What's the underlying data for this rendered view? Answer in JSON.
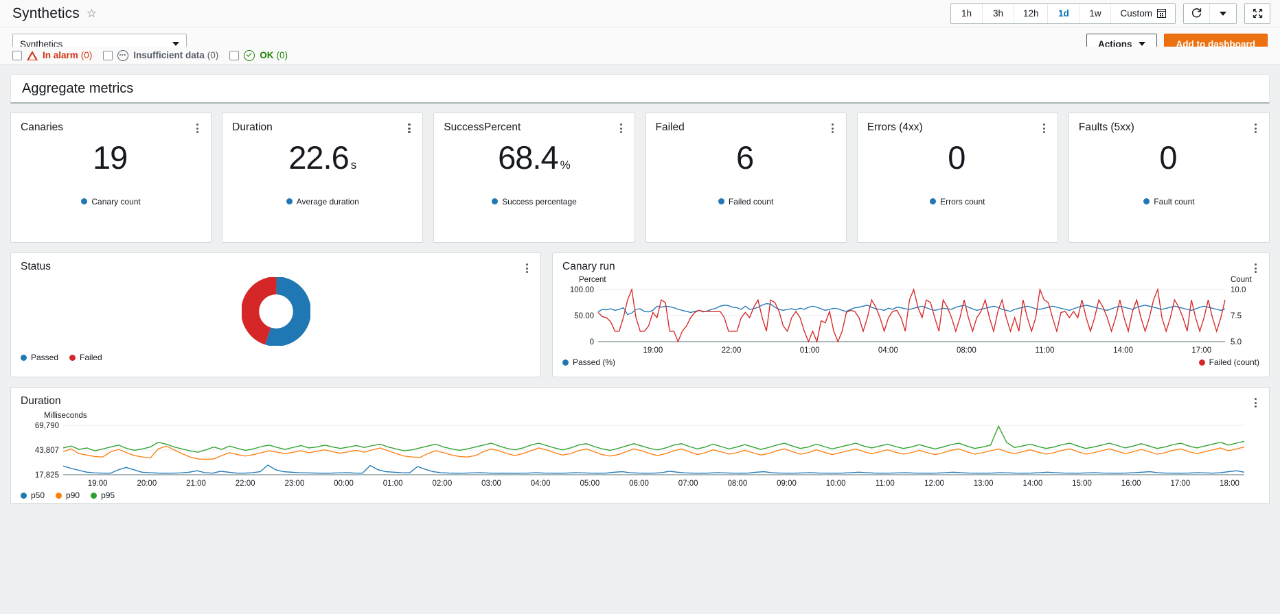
{
  "header": {
    "title": "Synthetics",
    "star_icon": "star-outline-icon",
    "time_ranges": [
      {
        "label": "1h",
        "active": false
      },
      {
        "label": "3h",
        "active": false
      },
      {
        "label": "12h",
        "active": false
      },
      {
        "label": "1d",
        "active": true
      },
      {
        "label": "1w",
        "active": false
      },
      {
        "label": "Custom",
        "active": false,
        "icon": "calendar-icon"
      }
    ],
    "refresh_icon": "refresh-icon",
    "refresh_dropdown_icon": "chevron-down-icon",
    "fullscreen_icon": "expand-icon"
  },
  "filters": {
    "namespace_select_value": "Synthetics",
    "select_caret_icon": "chevron-down-icon",
    "actions_label": "Actions",
    "actions_caret_icon": "chevron-down-icon",
    "add_to_dashboard_label": "Add to dashboard",
    "primary_color": "#ec7211",
    "statuses": [
      {
        "label": "In alarm",
        "count": "(0)",
        "color": "#d13212",
        "icon": "alarm-triangle-icon",
        "checked": false
      },
      {
        "label": "Insufficient data",
        "count": "(0)",
        "color": "#545b64",
        "icon": "insufficient-data-icon",
        "checked": false
      },
      {
        "label": "OK",
        "count": "(0)",
        "color": "#1d8102",
        "icon": "check-circle-icon",
        "checked": false
      }
    ]
  },
  "section": {
    "title": "Aggregate metrics"
  },
  "kpis": [
    {
      "title": "Canaries",
      "value": "19",
      "unit": "",
      "legend": "Canary count",
      "color": "#1f77b4",
      "menu_icon": "kebab-menu-icon"
    },
    {
      "title": "Duration",
      "value": "22.6",
      "unit": "s",
      "legend": "Average duration",
      "color": "#1f77b4",
      "menu_icon": "kebab-menu-icon"
    },
    {
      "title": "SuccessPercent",
      "value": "68.4",
      "unit": "%",
      "legend": "Success percentage",
      "color": "#1f77b4",
      "menu_icon": "kebab-menu-icon"
    },
    {
      "title": "Failed",
      "value": "6",
      "unit": "",
      "legend": "Failed count",
      "color": "#1f77b4",
      "menu_icon": "kebab-menu-icon"
    },
    {
      "title": "Errors (4xx)",
      "value": "0",
      "unit": "",
      "legend": "Errors count",
      "color": "#1f77b4",
      "menu_icon": "kebab-menu-icon"
    },
    {
      "title": "Faults (5xx)",
      "value": "0",
      "unit": "",
      "legend": "Fault count",
      "color": "#1f77b4",
      "menu_icon": "kebab-menu-icon"
    }
  ],
  "status_panel": {
    "title": "Status",
    "menu_icon": "kebab-menu-icon",
    "legend": [
      {
        "label": "Passed",
        "color": "#1f77b4"
      },
      {
        "label": "Failed",
        "color": "#d62728"
      }
    ]
  },
  "canary_panel": {
    "title": "Canary run",
    "menu_icon": "kebab-menu-icon",
    "legend": [
      {
        "label": "Passed (%)",
        "color": "#1f77b4"
      },
      {
        "label": "Failed (count)",
        "color": "#d62728"
      }
    ]
  },
  "duration_panel": {
    "title": "Duration",
    "menu_icon": "kebab-menu-icon",
    "legend": [
      {
        "label": "p50",
        "color": "#1f77b4"
      },
      {
        "label": "p90",
        "color": "#ff7f0e"
      },
      {
        "label": "p95",
        "color": "#2ca02c"
      }
    ]
  },
  "chart_data": [
    {
      "type": "pie",
      "title": "Status",
      "name": "status-donut",
      "labels": [
        "Passed",
        "Failed"
      ],
      "values": [
        55,
        45
      ],
      "colors": [
        "#1f77b4",
        "#d62728"
      ],
      "donut": true,
      "legend_position": "bottom-left"
    },
    {
      "type": "line",
      "title": "Canary run",
      "name": "canary-run-chart",
      "xlabel": "",
      "ylabel": "Percent",
      "y2label": "Count",
      "xticks": [
        "19:00",
        "22:00",
        "01:00",
        "04:00",
        "08:00",
        "11:00",
        "14:00",
        "17:00"
      ],
      "yticks": [
        "0",
        "50.00",
        "100.00"
      ],
      "ylim": [
        0,
        100
      ],
      "y2ticks": [
        "5.0",
        "7.5",
        "10.0"
      ],
      "y2lim": [
        5.0,
        10.0
      ],
      "grid": true,
      "legend_position": "bottom",
      "series": [
        {
          "name": "Passed (%)",
          "color": "#1f77b4",
          "axis": "left",
          "values": [
            57,
            62,
            61,
            63,
            60,
            62,
            65,
            52,
            55,
            62,
            63,
            58,
            57,
            60,
            68,
            66,
            68,
            67,
            65,
            62,
            60,
            58,
            56,
            58,
            60,
            57,
            59,
            62,
            64,
            68,
            70,
            69,
            66,
            65,
            62,
            68,
            62,
            63,
            66,
            70,
            73,
            72,
            66,
            62,
            60,
            62,
            63,
            61,
            64,
            62,
            66,
            68,
            66,
            63,
            60,
            62,
            64,
            63,
            60,
            58,
            62,
            65,
            66,
            68,
            70,
            66,
            63,
            62,
            60,
            64,
            62,
            66,
            65,
            63,
            62,
            64,
            66,
            68,
            65,
            62,
            60,
            62,
            64,
            63,
            62,
            66,
            68,
            70,
            66,
            63,
            60,
            62,
            64,
            66,
            68,
            66,
            62,
            60,
            58,
            62,
            64,
            66,
            68,
            66,
            63,
            62,
            64,
            66,
            68,
            66,
            64,
            62,
            60,
            63,
            66,
            68,
            70,
            68,
            66,
            64,
            62,
            60,
            63,
            66,
            68,
            66,
            64,
            62,
            66,
            68,
            70,
            68,
            66,
            64,
            62,
            64,
            66,
            68,
            66,
            64,
            62,
            60,
            63,
            66,
            68,
            66,
            64,
            62,
            60,
            63
          ]
        },
        {
          "name": "Failed (count)",
          "color": "#d62728",
          "axis": "right",
          "values": [
            56,
            48,
            46,
            38,
            20,
            20,
            46,
            80,
            100,
            46,
            20,
            20,
            30,
            56,
            46,
            80,
            75,
            20,
            20,
            0,
            20,
            30,
            46,
            56,
            60,
            58,
            58,
            58,
            58,
            58,
            46,
            20,
            20,
            20,
            46,
            56,
            46,
            66,
            80,
            46,
            20,
            80,
            75,
            58,
            30,
            20,
            46,
            58,
            46,
            20,
            0,
            20,
            0,
            40,
            36,
            58,
            20,
            0,
            20,
            56,
            60,
            58,
            46,
            20,
            46,
            80,
            66,
            46,
            20,
            46,
            58,
            60,
            46,
            20,
            80,
            100,
            66,
            46,
            80,
            75,
            46,
            20,
            80,
            66,
            46,
            20,
            46,
            80,
            46,
            20,
            46,
            58,
            80,
            46,
            20,
            58,
            80,
            46,
            20,
            46,
            20,
            80,
            46,
            20,
            46,
            100,
            80,
            75,
            46,
            20,
            56,
            58,
            46,
            58,
            46,
            80,
            46,
            20,
            46,
            80,
            66,
            46,
            20,
            46,
            80,
            46,
            20,
            58,
            80,
            46,
            20,
            46,
            80,
            100,
            46,
            20,
            46,
            80,
            66,
            46,
            20,
            80,
            46,
            20,
            46,
            80,
            46,
            20,
            46,
            80
          ]
        }
      ]
    },
    {
      "type": "line",
      "title": "Duration",
      "name": "duration-chart",
      "xlabel": "",
      "ylabel": "Milliseconds",
      "xticks": [
        "19:00",
        "20:00",
        "21:00",
        "22:00",
        "23:00",
        "00:00",
        "01:00",
        "02:00",
        "03:00",
        "04:00",
        "05:00",
        "06:00",
        "07:00",
        "08:00",
        "09:00",
        "10:00",
        "11:00",
        "12:00",
        "13:00",
        "14:00",
        "15:00",
        "16:00",
        "17:00",
        "18:00"
      ],
      "yticks": [
        "17,825",
        "43,807",
        "69,790"
      ],
      "ylim": [
        17825,
        69790
      ],
      "grid": true,
      "legend_position": "bottom",
      "series": [
        {
          "name": "p50",
          "color": "#1f77b4",
          "values": [
            27000,
            24500,
            22500,
            20500,
            19800,
            19500,
            19400,
            23000,
            25500,
            23000,
            20500,
            20000,
            19600,
            19400,
            19500,
            19800,
            20500,
            22000,
            20000,
            19500,
            21500,
            20500,
            19600,
            19500,
            20000,
            21000,
            28000,
            23000,
            21000,
            20500,
            20000,
            19800,
            19600,
            19400,
            19500,
            19800,
            20000,
            19600,
            19500,
            27500,
            23000,
            21000,
            20500,
            20000,
            19800,
            26500,
            23500,
            21000,
            20000,
            19600,
            19400,
            19500,
            19800,
            20000,
            19600,
            19400,
            19500,
            19300,
            19400,
            19500,
            20000,
            19600,
            19500,
            19400,
            19600,
            20000,
            19800,
            19500,
            19400,
            19600,
            20500,
            21000,
            20000,
            19600,
            19400,
            19500,
            20000,
            21500,
            20500,
            19800,
            19500,
            19400,
            19600,
            20000,
            19800,
            19500,
            19400,
            19600,
            20500,
            21000,
            20000,
            19600,
            19400,
            19500,
            19800,
            20000,
            19600,
            19500,
            19400,
            19600,
            20000,
            20500,
            20000,
            19600,
            19400,
            19500,
            19800,
            20000,
            19600,
            19500,
            19400,
            19600,
            20000,
            20500,
            20000,
            19600,
            19500,
            19400,
            19600,
            20000,
            19800,
            19500,
            19400,
            19600,
            20000,
            20500,
            20000,
            19600,
            19500,
            19400,
            19800,
            20000,
            19600,
            19500,
            19400,
            19600,
            20000,
            20500,
            21000,
            20000,
            19600,
            19500,
            19400,
            19600,
            20000,
            19800,
            19500,
            20000,
            21000,
            22000,
            20500
          ]
        },
        {
          "name": "p90",
          "color": "#ff7f0e",
          "values": [
            42000,
            45000,
            40000,
            38500,
            37000,
            36500,
            42000,
            44500,
            41000,
            38000,
            36500,
            35500,
            45000,
            48000,
            44000,
            40000,
            36500,
            34500,
            34000,
            34500,
            38000,
            41000,
            39000,
            37500,
            39000,
            41000,
            43000,
            41500,
            40000,
            41500,
            43000,
            41000,
            42500,
            44000,
            42000,
            40500,
            42000,
            43500,
            41500,
            44000,
            46000,
            43000,
            40000,
            37500,
            36500,
            36000,
            40000,
            43000,
            41000,
            38500,
            37000,
            36500,
            38000,
            42000,
            45000,
            43000,
            40000,
            38000,
            40000,
            43000,
            46000,
            44000,
            41000,
            38500,
            40000,
            43000,
            45000,
            42000,
            39000,
            37500,
            39000,
            42000,
            45000,
            43000,
            40000,
            38000,
            40000,
            43000,
            45000,
            42000,
            39000,
            41000,
            44000,
            42000,
            39500,
            41000,
            43500,
            41000,
            38500,
            40000,
            43000,
            45000,
            42000,
            39500,
            41000,
            44000,
            41500,
            39000,
            41000,
            43000,
            45000,
            42000,
            40000,
            42000,
            44000,
            41500,
            39500,
            41000,
            43500,
            41000,
            39000,
            41000,
            43500,
            45000,
            42000,
            39500,
            41000,
            43000,
            45000,
            42000,
            40000,
            42000,
            44000,
            41500,
            39500,
            41000,
            43500,
            45000,
            42000,
            39500,
            41000,
            43000,
            45000,
            42500,
            40000,
            42000,
            44500,
            42000,
            39500,
            41000,
            43500,
            45000,
            42000,
            40000,
            42000,
            44000,
            46000,
            43000,
            45000,
            47000
          ]
        },
        {
          "name": "p95",
          "color": "#2ca02c",
          "values": [
            46000,
            48000,
            44500,
            46000,
            43000,
            45000,
            47000,
            49000,
            45500,
            43500,
            45000,
            47000,
            52000,
            50000,
            47000,
            45000,
            43000,
            41500,
            44000,
            47000,
            44500,
            48000,
            45500,
            43500,
            45000,
            47500,
            49000,
            46500,
            44500,
            46500,
            48500,
            46000,
            47000,
            49000,
            47000,
            45500,
            47000,
            48500,
            46500,
            48500,
            50000,
            47000,
            45000,
            43000,
            44000,
            46000,
            48000,
            50000,
            47000,
            45000,
            43500,
            45000,
            47000,
            49000,
            51000,
            48000,
            45500,
            44000,
            46000,
            49000,
            51000,
            48500,
            46000,
            44000,
            46000,
            49000,
            50500,
            47500,
            45000,
            43500,
            45500,
            48000,
            50500,
            48000,
            45500,
            44000,
            46000,
            49000,
            50500,
            47500,
            45000,
            47000,
            50000,
            47500,
            45000,
            47000,
            49500,
            47000,
            44500,
            46500,
            49000,
            51000,
            48000,
            45500,
            47000,
            50000,
            47500,
            45000,
            47000,
            49000,
            51000,
            48000,
            46000,
            48000,
            50000,
            47500,
            45500,
            47000,
            49500,
            47000,
            45000,
            47000,
            49500,
            51000,
            48000,
            45500,
            47000,
            49000,
            69000,
            52000,
            46500,
            48000,
            50000,
            47500,
            45500,
            47000,
            49500,
            51000,
            48000,
            45500,
            47000,
            49000,
            51000,
            48500,
            46000,
            48000,
            50500,
            48000,
            45500,
            47000,
            49500,
            51000,
            48000,
            46000,
            48000,
            50000,
            52000,
            49000,
            51000,
            53000
          ]
        }
      ]
    }
  ]
}
